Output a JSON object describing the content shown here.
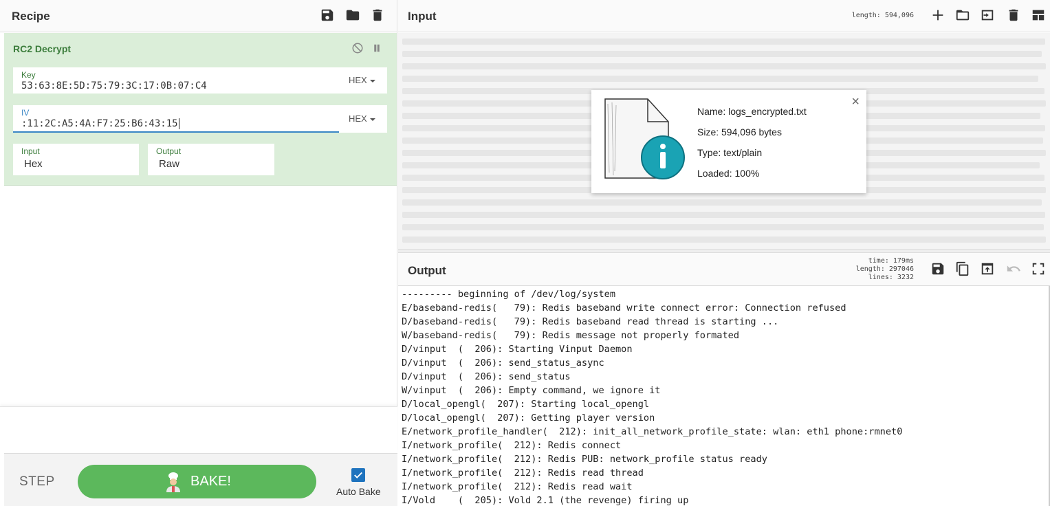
{
  "recipe": {
    "title": "Recipe",
    "icons": [
      "save-icon",
      "folder-icon",
      "trash-icon"
    ],
    "operation": {
      "name": "RC2 Decrypt",
      "key": {
        "label": "Key",
        "value": "53:63:8E:5D:75:79:3C:17:0B:07:C4",
        "format": "HEX"
      },
      "iv": {
        "label": "IV",
        "value": ":11:2C:A5:4A:F7:25:B6:43:15",
        "format": "HEX"
      },
      "input": {
        "label": "Input",
        "value": "Hex"
      },
      "output": {
        "label": "Output",
        "value": "Raw"
      }
    }
  },
  "controls": {
    "step": "STEP",
    "bake": "BAKE!",
    "auto_bake_label": "Auto Bake",
    "auto_bake_checked": true
  },
  "input": {
    "title": "Input",
    "length_info": "length: 594,096",
    "file": {
      "name": "Name: logs_encrypted.txt",
      "size": "Size: 594,096 bytes",
      "type": "Type: text/plain",
      "loaded": "Loaded: 100%",
      "close": "×"
    }
  },
  "output": {
    "title": "Output",
    "stats": {
      "time": "time:  179ms",
      "length": "length: 297046",
      "lines": "lines:   3232"
    },
    "lines": [
      "--------- beginning of /dev/log/system",
      "E/baseband-redis(   79): Redis baseband write connect error: Connection refused",
      "D/baseband-redis(   79): Redis baseband read thread is starting ...",
      "W/baseband-redis(   79): Redis message not properly formated",
      "D/vinput  (  206): Starting Vinput Daemon",
      "D/vinput  (  206): send_status_async",
      "D/vinput  (  206): send_status",
      "W/vinput  (  206): Empty command, we ignore it",
      "D/local_opengl(  207): Starting local_opengl",
      "D/local_opengl(  207): Getting player version",
      "E/network_profile_handler(  212): init_all_network_profile_state: wlan: eth1 phone:rmnet0",
      "I/network_profile(  212): Redis connect",
      "I/network_profile(  212): Redis PUB: network_profile status ready",
      "I/network_profile(  212): Redis read thread",
      "I/network_profile(  212): Redis read wait",
      "I/Vold    (  205): Vold 2.1 (the revenge) firing up"
    ]
  }
}
